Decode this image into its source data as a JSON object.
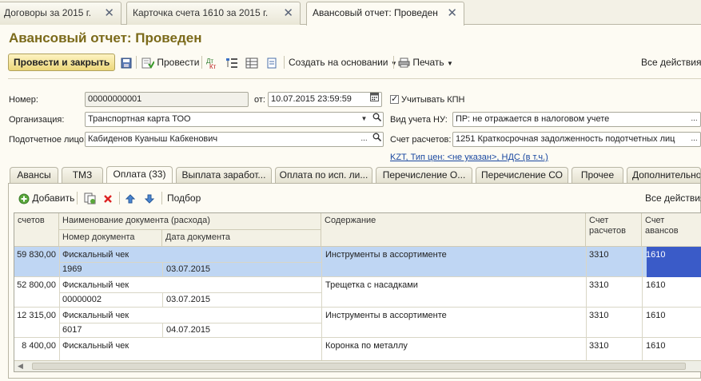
{
  "window_tabs": [
    {
      "label": "Договоры  за 2015 г.",
      "close": "✕"
    },
    {
      "label": "Карточка счета 1610  за 2015 г.",
      "close": "✕"
    },
    {
      "label": "Авансовый отчет: Проведен",
      "close": "✕"
    }
  ],
  "title": "Авансовый отчет: Проведен",
  "toolbar": {
    "post_close": "Провести и закрыть",
    "post": "Провести",
    "create_based": "Создать на основании",
    "print": "Печать",
    "all_actions": "Все действия"
  },
  "form": {
    "number_label": "Номер:",
    "number_value": "00000000001",
    "date_label": "от:",
    "date_value": "10.07.2015 23:59:59",
    "org_label": "Организация:",
    "org_value": "Транспортная карта ТОО",
    "person_label": "Подотчетное лицо:",
    "person_value": "Кабиденов Куаныш Кабкенович",
    "kpn_label": "Учитывать КПН",
    "nu_label": "Вид учета НУ:",
    "nu_value": "ПР: не отражается в налоговом учете",
    "account_label": "Счет расчетов:",
    "account_value": "1251 Краткосрочная задолженность подотчетных лиц",
    "price_link": "KZT, Тип цен: <не указан>, НДС (в т.ч.)"
  },
  "page_tabs": [
    "Авансы",
    "ТМЗ",
    "Оплата (33)",
    "Выплата заработ...",
    "Оплата по исп. ли...",
    "Перечисление О...",
    "Перечисление СО",
    "Прочее",
    "Дополнительно"
  ],
  "grid_toolbar": {
    "add": "Добавить",
    "selection": "Подбор",
    "all_actions": "Все действия"
  },
  "columns": {
    "amount": "счетов",
    "doc_name": "Наименование документа (расхода)",
    "doc_number": "Номер документа",
    "doc_date": "Дата документа",
    "content": "Содержание",
    "acc_settle": "Счет расчетов",
    "acc_adv": "Счет авансов"
  },
  "rows": [
    {
      "amount": "59 830,00",
      "doc_name": "Фискальный чек",
      "doc_number": "1969",
      "doc_date": "03.07.2015",
      "content": "Инструменты в ассортименте",
      "acc_settle": "3310",
      "acc_adv": "1610"
    },
    {
      "amount": "52 800,00",
      "doc_name": "Фискальный чек",
      "doc_number": "00000002",
      "doc_date": "03.07.2015",
      "content": "Трещетка с насадками",
      "acc_settle": "3310",
      "acc_adv": "1610"
    },
    {
      "amount": "12 315,00",
      "doc_name": "Фискальный чек",
      "doc_number": "6017",
      "doc_date": "04.07.2015",
      "content": "Инструменты в ассортименте",
      "acc_settle": "3310",
      "acc_adv": "1610"
    },
    {
      "amount": "8 400,00",
      "doc_name": "Фискальный чек",
      "doc_number": "",
      "doc_date": "",
      "content": "Коронка по металлу",
      "acc_settle": "3310",
      "acc_adv": "1610"
    }
  ]
}
